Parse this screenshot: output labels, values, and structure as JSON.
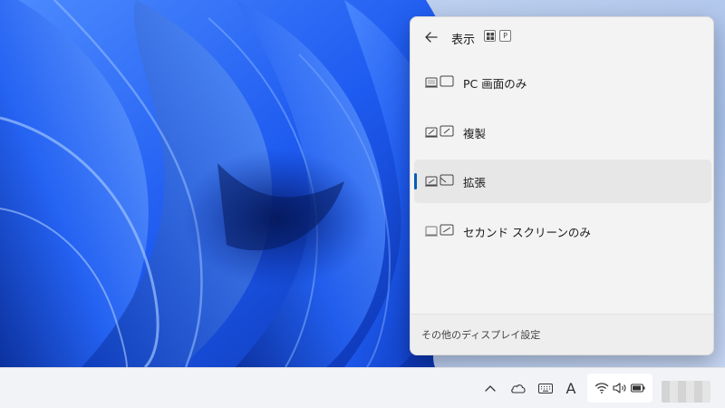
{
  "flyout": {
    "title": "表示",
    "shortcut_keys": [
      "⊞",
      "P"
    ],
    "options": [
      {
        "label": "PC 画面のみ",
        "icon": "pc-screen-only-icon",
        "selected": false
      },
      {
        "label": "複製",
        "icon": "duplicate-icon",
        "selected": false
      },
      {
        "label": "拡張",
        "icon": "extend-icon",
        "selected": true
      },
      {
        "label": "セカンド スクリーンのみ",
        "icon": "second-screen-only-icon",
        "selected": false
      }
    ],
    "footer_link": "その他のディスプレイ設定"
  },
  "taskbar": {
    "ime_indicator": "A"
  },
  "colors": {
    "accent": "#005fb8",
    "flyout_bg": "#f3f3f3",
    "taskbar_bg": "#f2f3f7",
    "wallpaper_blue": "#1f57e6"
  }
}
